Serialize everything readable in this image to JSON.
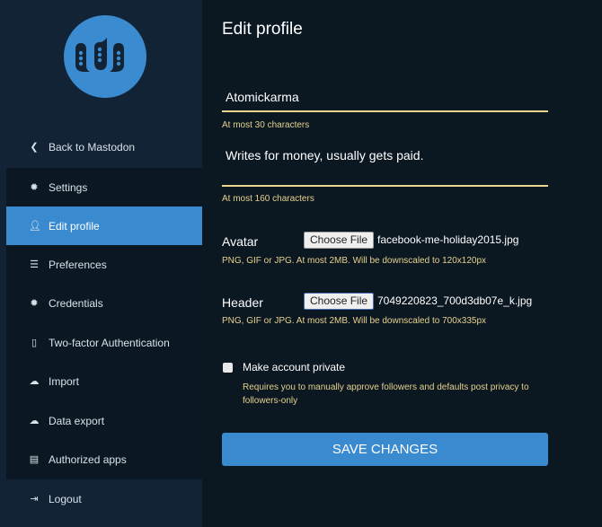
{
  "colors": {
    "accent": "#3a8ad0",
    "hint": "#e6d28e",
    "sidebar": "#112335",
    "main": "#0b1721"
  },
  "sidebar": {
    "logo": "mastodon-logo",
    "back": {
      "label": "Back to Mastodon",
      "icon": "chevron-left-icon"
    },
    "items": [
      {
        "label": "Settings",
        "icon": "gear-icon"
      },
      {
        "label": "Edit profile",
        "icon": "user-icon",
        "active": true
      },
      {
        "label": "Preferences",
        "icon": "sliders-icon"
      },
      {
        "label": "Credentials",
        "icon": "gear-icon"
      },
      {
        "label": "Two-factor Authentication",
        "icon": "mobile-icon"
      },
      {
        "label": "Import",
        "icon": "cloud-upload-icon"
      },
      {
        "label": "Data export",
        "icon": "cloud-download-icon"
      },
      {
        "label": "Authorized apps",
        "icon": "list-icon"
      }
    ],
    "logout": {
      "label": "Logout",
      "icon": "sign-out-icon"
    }
  },
  "main": {
    "title": "Edit profile",
    "display_name": {
      "value": "Atomickarma",
      "hint": "At most 30 characters"
    },
    "bio": {
      "value": "Writes for money, usually gets paid.",
      "hint": "At most 160 characters"
    },
    "avatar": {
      "label": "Avatar",
      "button": "Choose File",
      "file": "facebook-me-holiday2015.jpg",
      "hint": "PNG, GIF or JPG. At most 2MB. Will be downscaled to 120x120px"
    },
    "header": {
      "label": "Header",
      "button": "Choose File",
      "file": "7049220823_700d3db07e_k.jpg",
      "hint": "PNG, GIF or JPG. At most 2MB. Will be downscaled to 700x335px"
    },
    "private": {
      "label": "Make account private",
      "checked": false,
      "hint": "Requires you to manually approve followers and defaults post privacy to followers-only"
    },
    "save": "SAVE CHANGES"
  }
}
